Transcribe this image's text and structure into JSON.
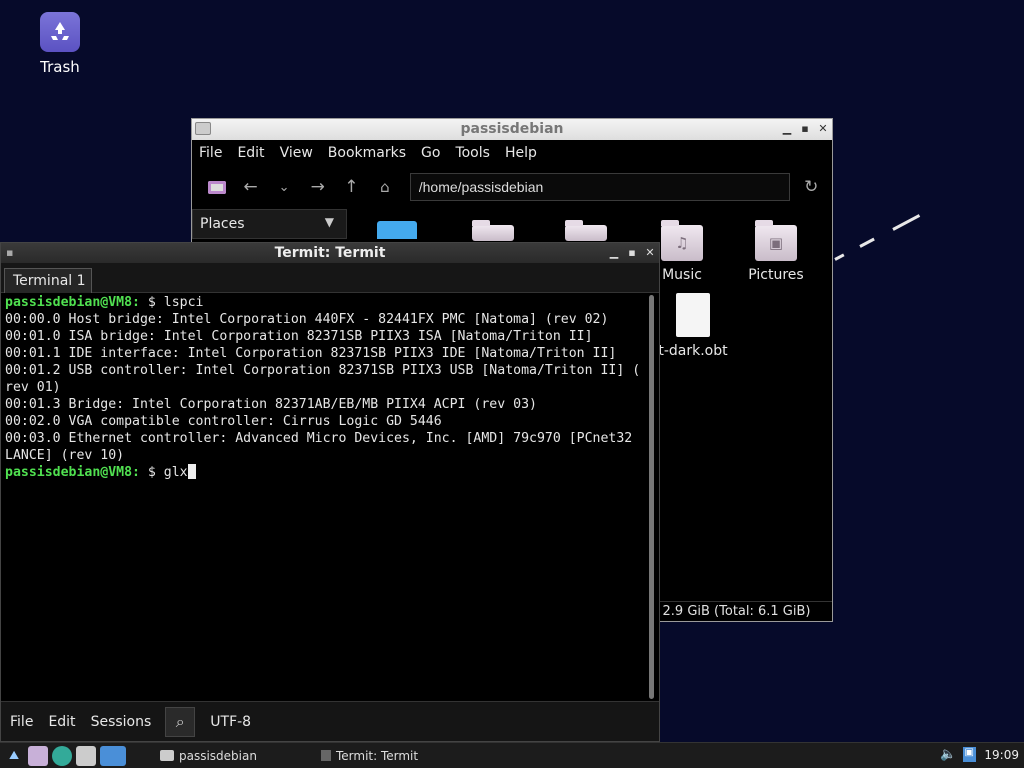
{
  "desktop": {
    "trash_label": "Trash"
  },
  "file_manager": {
    "title": "passisdebian",
    "menu": [
      "File",
      "Edit",
      "View",
      "Bookmarks",
      "Go",
      "Tools",
      "Help"
    ],
    "address": "/home/passisdebian",
    "places_label": "Places",
    "items": [
      {
        "label": "Music",
        "icon": "music-folder-icon"
      },
      {
        "label": "Pictures",
        "icon": "pictures-folder-icon"
      },
      {
        "label": "t-dark.obt",
        "icon": "file-icon"
      }
    ],
    "status": ": 2.9 GiB (Total: 6.1 GiB)"
  },
  "terminal": {
    "title": "Termit: Termit",
    "tab_label": "Terminal 1",
    "lines": [
      {
        "prompt": "passisdebian@VM8:",
        "cmd": " $ lspci"
      },
      {
        "text": "00:00.0 Host bridge: Intel Corporation 440FX - 82441FX PMC [Natoma] (rev 02)"
      },
      {
        "text": "00:01.0 ISA bridge: Intel Corporation 82371SB PIIX3 ISA [Natoma/Triton II]"
      },
      {
        "text": "00:01.1 IDE interface: Intel Corporation 82371SB PIIX3 IDE [Natoma/Triton II]"
      },
      {
        "text": "00:01.2 USB controller: Intel Corporation 82371SB PIIX3 USB [Natoma/Triton II] ("
      },
      {
        "text": "rev 01)"
      },
      {
        "text": "00:01.3 Bridge: Intel Corporation 82371AB/EB/MB PIIX4 ACPI (rev 03)"
      },
      {
        "text": "00:02.0 VGA compatible controller: Cirrus Logic GD 5446"
      },
      {
        "text": "00:03.0 Ethernet controller: Advanced Micro Devices, Inc. [AMD] 79c970 [PCnet32"
      },
      {
        "text": "LANCE] (rev 10)"
      },
      {
        "prompt": "passisdebian@VM8:",
        "cmd": " $ glx",
        "cursor": true
      }
    ],
    "bottom_menu": [
      "File",
      "Edit",
      "Sessions"
    ],
    "encoding": "UTF-8"
  },
  "taskbar": {
    "tasks": [
      {
        "label": "passisdebian"
      },
      {
        "label": "Termit: Termit"
      }
    ],
    "clock": "19:09"
  }
}
